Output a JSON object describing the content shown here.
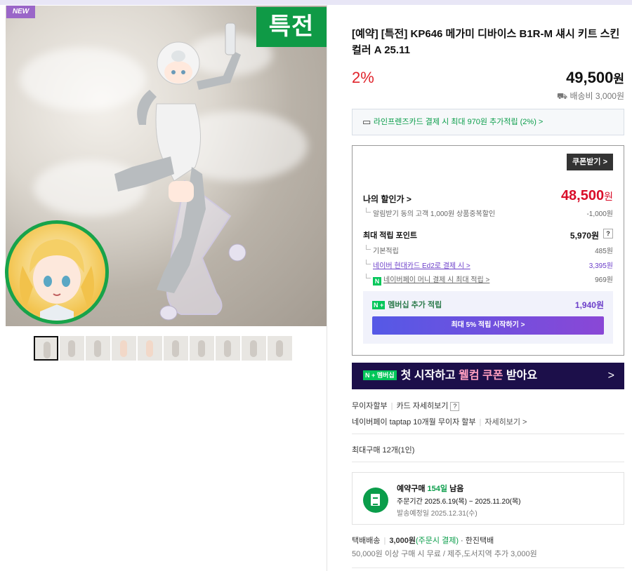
{
  "gallery": {
    "new_badge": "NEW",
    "special_badge": "특전",
    "thumbnail_count": 10
  },
  "product": {
    "title": "[예약] [특전] KP646 메가미 디바이스 B1R-M 섀시 키트 스킨 컬러 A 25.11",
    "discount_rate": "2%",
    "price": "49,500",
    "won": "원",
    "shipping_fee": "배송비 3,000원"
  },
  "card_promo": "라인프렌즈카드 결제 시 최대 970원 추가적립 (2%) >",
  "benefit": {
    "coupon_button": "쿠폰받기 >",
    "my_price_label": "나의 할인가 >",
    "my_price": "48,500",
    "my_price_unit": "원",
    "alarm_discount_label": "알림받기 동의 고객 1,000원 상품중복할인",
    "alarm_discount_value": "-1,000원",
    "max_point_label": "최대 적립 포인트",
    "max_point_value": "5,970원",
    "help": "?",
    "basic_label": "기본적립",
    "basic_value": "485원",
    "card_label": "네이버 현대카드 Ed2로 결제 시 >",
    "card_value": "3,395원",
    "pay_label": "네이버페이 머니 결제 시 최대 적립 >",
    "pay_value": "969원",
    "npay_mark": "N",
    "member_tag": "N +",
    "member_label": "멤버십 추가 적립",
    "member_value": "1,940원",
    "member_button": "최대 5% 적립 시작하기 >"
  },
  "banner": {
    "tag": "N + 멤버십",
    "text_before": "첫 시작하고 ",
    "highlight": "웰컴 쿠폰",
    "text_after": " 받아요",
    "arrow": ">"
  },
  "installment": {
    "label": "무이자할부",
    "card_detail": "카드 자세히보기",
    "help": "?",
    "taptap": "네이버페이 taptap 10개월 무이자 할부",
    "detail": "자세히보기 >"
  },
  "max_purchase": "최대구매 12개(1인)",
  "presale": {
    "title_prefix": "예약구매 ",
    "days": "154일",
    "title_suffix": " 남음",
    "order_period": "주문기간  2025.6.19(목) ~ 2025.11.20(목)",
    "ship_date": "발송예정일  2025.12.31(수)"
  },
  "delivery": {
    "method": "택배배송",
    "fee": "3,000원",
    "payment": "(주문시 결제)",
    "courier": "· 한진택배",
    "note": "50,000원 이상 구매 시 무료 / 제주,도서지역 추가 3,000원"
  },
  "colors": {
    "accent_green": "#03c75a",
    "sale_red": "#d90e2a",
    "purple": "#6b3ec9"
  }
}
